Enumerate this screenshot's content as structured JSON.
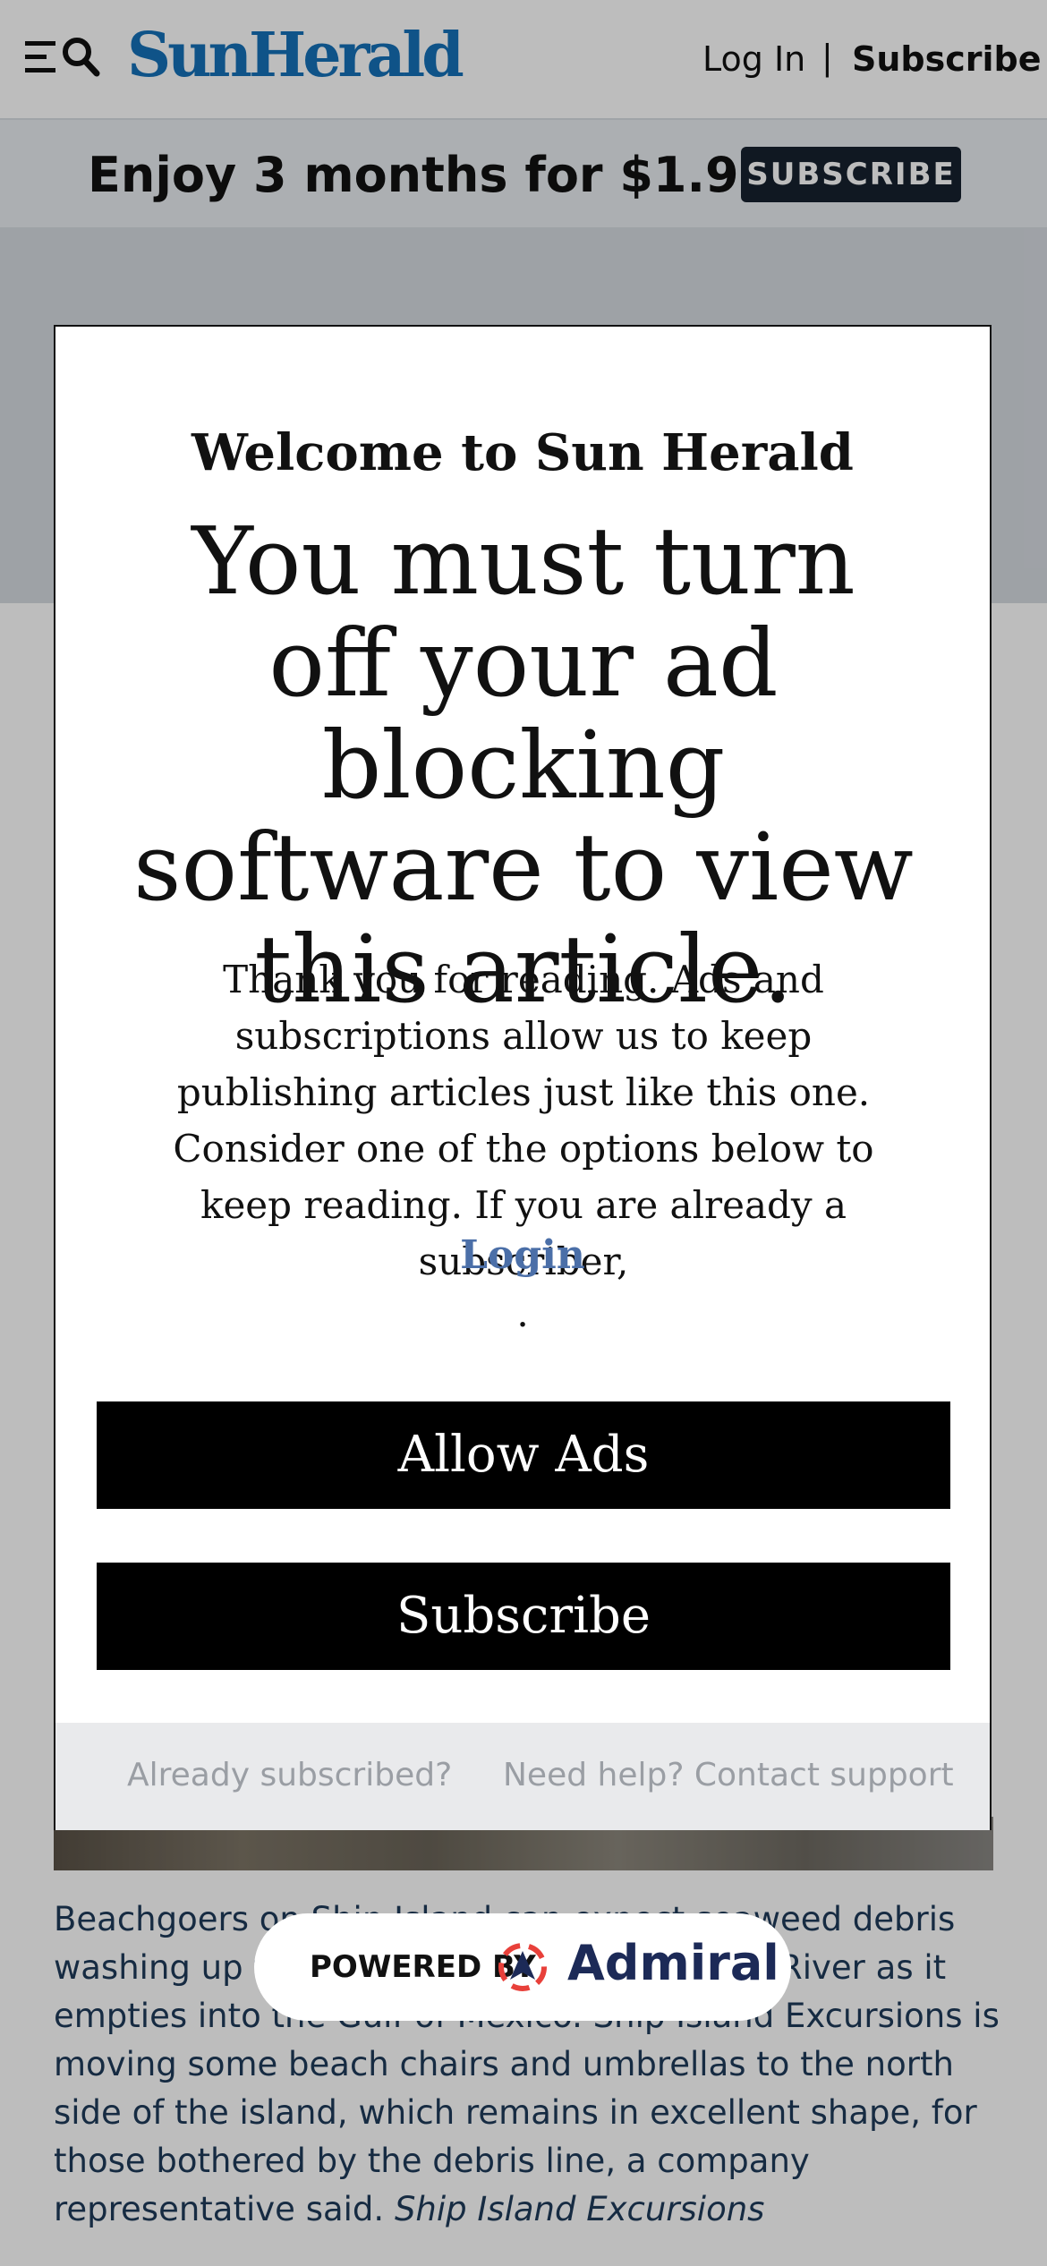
{
  "header": {
    "logo": "SunHerald",
    "login_label": "Log In",
    "separator": "|",
    "subscribe_label": "Subscribe"
  },
  "promo": {
    "text": "Enjoy 3 months for $1.99!",
    "button_label": "SUBSCRIBE"
  },
  "article": {
    "caption": "Beachgoers on Ship Island can expect seaweed debris washing up from flooding of the Mississippi River as it empties into the Gulf of Mexico. Ship Island Excursions is moving some beach chairs and umbrellas to the north side of the island, which remains in excellent shape, for those bothered by the debris line, a company representative said.",
    "credit": "Ship Island Excursions"
  },
  "modal": {
    "welcome": "Welcome to Sun Herald",
    "headline": "You must turn off your ad blocking software to view this article.",
    "body": "Thank you for reading. Ads and subscriptions allow us to keep publishing articles just like this one. Consider one of the options below to keep reading. If you are already a subscriber,",
    "login_link": "Login",
    "period": ".",
    "allow_ads_label": "Allow Ads",
    "subscribe_label": "Subscribe",
    "footer_already": "Already subscribed?",
    "footer_help": "Need help? Contact support"
  },
  "badge": {
    "powered_by": "POWERED BY",
    "brand": "Admiral"
  },
  "colors": {
    "brand_blue": "#1570b8",
    "link_blue": "#4b6fa8",
    "dark_navy": "#16212e",
    "admiral_red": "#e8403a",
    "admiral_navy": "#1c2a57"
  },
  "icons": [
    "menu-icon",
    "search-icon",
    "admiral-logo-icon"
  ]
}
